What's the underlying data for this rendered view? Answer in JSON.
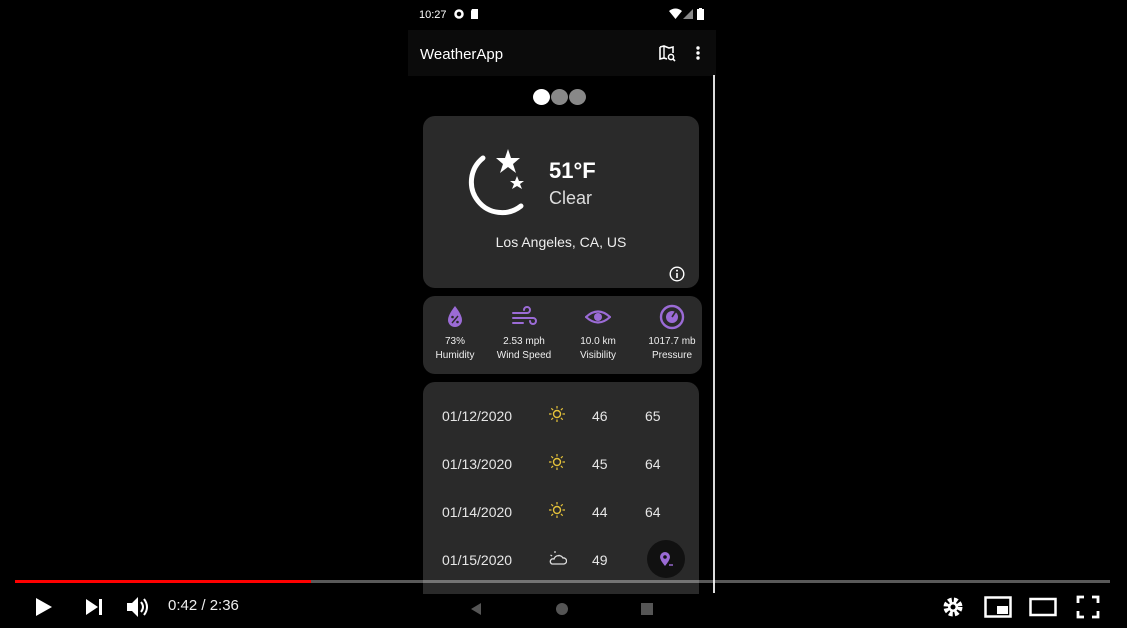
{
  "status_bar": {
    "time": "10:27"
  },
  "app_bar": {
    "title": "WeatherApp"
  },
  "current": {
    "temperature": "51°F",
    "condition": "Clear",
    "location": "Los Angeles, CA, US"
  },
  "stats": [
    {
      "value": "73%",
      "label": "Humidity",
      "icon": "humidity-icon"
    },
    {
      "value": "2.53 mph",
      "label": "Wind Speed",
      "icon": "wind-icon"
    },
    {
      "value": "10.0 km",
      "label": "Visibility",
      "icon": "eye-icon"
    },
    {
      "value": "1017.7 mb",
      "label": "Pressure",
      "icon": "gauge-icon"
    }
  ],
  "forecast": [
    {
      "date": "01/12/2020",
      "low": "46",
      "high": "65",
      "icon": "sun-icon"
    },
    {
      "date": "01/13/2020",
      "low": "45",
      "high": "64",
      "icon": "sun-icon"
    },
    {
      "date": "01/14/2020",
      "low": "44",
      "high": "64",
      "icon": "sun-icon"
    },
    {
      "date": "01/15/2020",
      "low": "49",
      "high": "",
      "icon": "partly-cloudy-icon"
    }
  ],
  "player": {
    "time": "0:42 / 2:36",
    "progress": 0.27
  },
  "colors": {
    "accent": "#9b6bd6",
    "sun": "#e5c23a",
    "progress": "#ff0000"
  }
}
